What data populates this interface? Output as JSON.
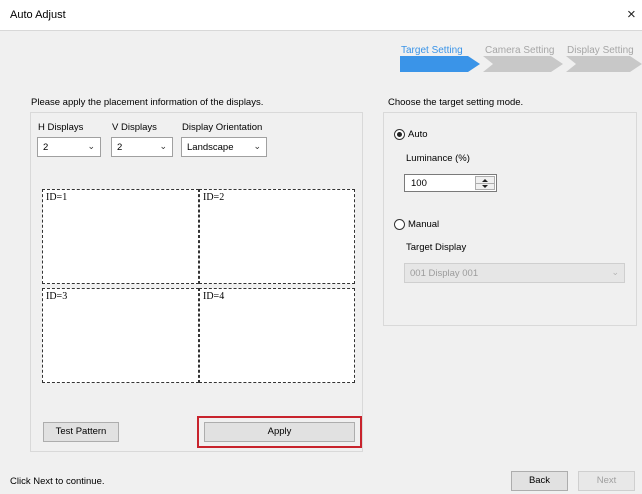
{
  "window": {
    "title": "Auto Adjust",
    "close_glyph": "×"
  },
  "steps": [
    {
      "label": "Target Setting",
      "color": "#3a94e8",
      "active": true
    },
    {
      "label": "Camera Setting",
      "color": "#c8c8c8",
      "active": false
    },
    {
      "label": "Display Setting",
      "color": "#c8c8c8",
      "active": false
    }
  ],
  "left_panel": {
    "instruction": "Please apply the placement information of the displays.",
    "h_displays": {
      "label": "H Displays",
      "value": "2"
    },
    "v_displays": {
      "label": "V Displays",
      "value": "2"
    },
    "orientation": {
      "label": "Display Orientation",
      "value": "Landscape"
    },
    "cells": [
      "ID=1",
      "ID=2",
      "ID=3",
      "ID=4"
    ],
    "test_pattern_label": "Test Pattern",
    "apply_label": "Apply"
  },
  "right_panel": {
    "heading": "Choose the target setting mode.",
    "auto": {
      "label": "Auto",
      "selected": true
    },
    "luminance_label": "Luminance (%)",
    "luminance_value": "100",
    "manual": {
      "label": "Manual",
      "selected": false
    },
    "target_display_label": "Target Display",
    "target_display_value": "001 Display 001"
  },
  "footer": {
    "hint": "Click Next to continue.",
    "back_label": "Back",
    "next_label": "Next"
  },
  "colors": {
    "accent": "#3a94e8",
    "highlight": "#c8232c"
  },
  "icons": {
    "close": "close-icon",
    "chevron": "chevron-down-icon",
    "spinner": "spinner-arrows-icon"
  }
}
